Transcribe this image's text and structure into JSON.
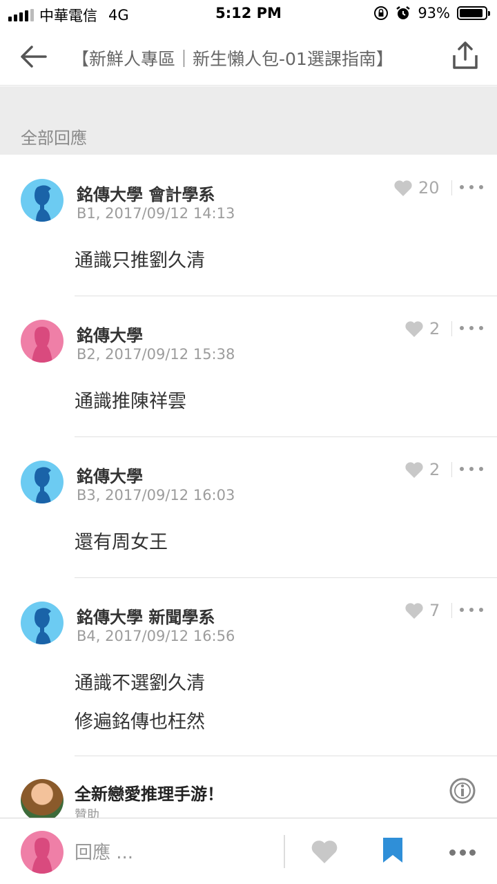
{
  "status_bar": {
    "carrier": "中華電信",
    "network": "4G",
    "time": "5:12 PM",
    "battery": "93%",
    "battery_level": 0.93
  },
  "nav": {
    "title": "【新鮮人專區｜新生懶人包-01選課指南】",
    "back_icon": "arrow-left-icon",
    "share_icon": "share-upload-icon"
  },
  "section": {
    "label": "全部回應"
  },
  "comments": [
    {
      "author": "銘傳大學 會計學系",
      "meta": "B1, 2017/09/12 14:13",
      "likes": "20",
      "lines": [
        "通識只推劉久清"
      ],
      "avatar_color": "#6ccbf2"
    },
    {
      "author": "銘傳大學",
      "meta": "B2, 2017/09/12 15:38",
      "likes": "2",
      "lines": [
        "通識推陳祥雲"
      ],
      "avatar_color": "#ef7fa7"
    },
    {
      "author": "銘傳大學",
      "meta": "B3, 2017/09/12 16:03",
      "likes": "2",
      "lines": [
        "還有周女王"
      ],
      "avatar_color": "#6ccbf2"
    },
    {
      "author": "銘傳大學 新聞學系",
      "meta": "B4, 2017/09/12 16:56",
      "likes": "7",
      "lines": [
        "通識不選劉久清",
        "修遍銘傳也枉然"
      ],
      "avatar_color": "#6ccbf2"
    }
  ],
  "sponsored": {
    "title": "全新戀愛推理手游！",
    "label": "贊助"
  },
  "bottom_bar": {
    "reply_placeholder": "回應 ...",
    "bookmark_color": "#2f8fd8"
  },
  "colors": {
    "avatar_blue": "#6ccbf2",
    "avatar_pink": "#ef7fa7",
    "silhouette_blue": "#1a63a8",
    "silhouette_pink": "#d94a7e"
  }
}
